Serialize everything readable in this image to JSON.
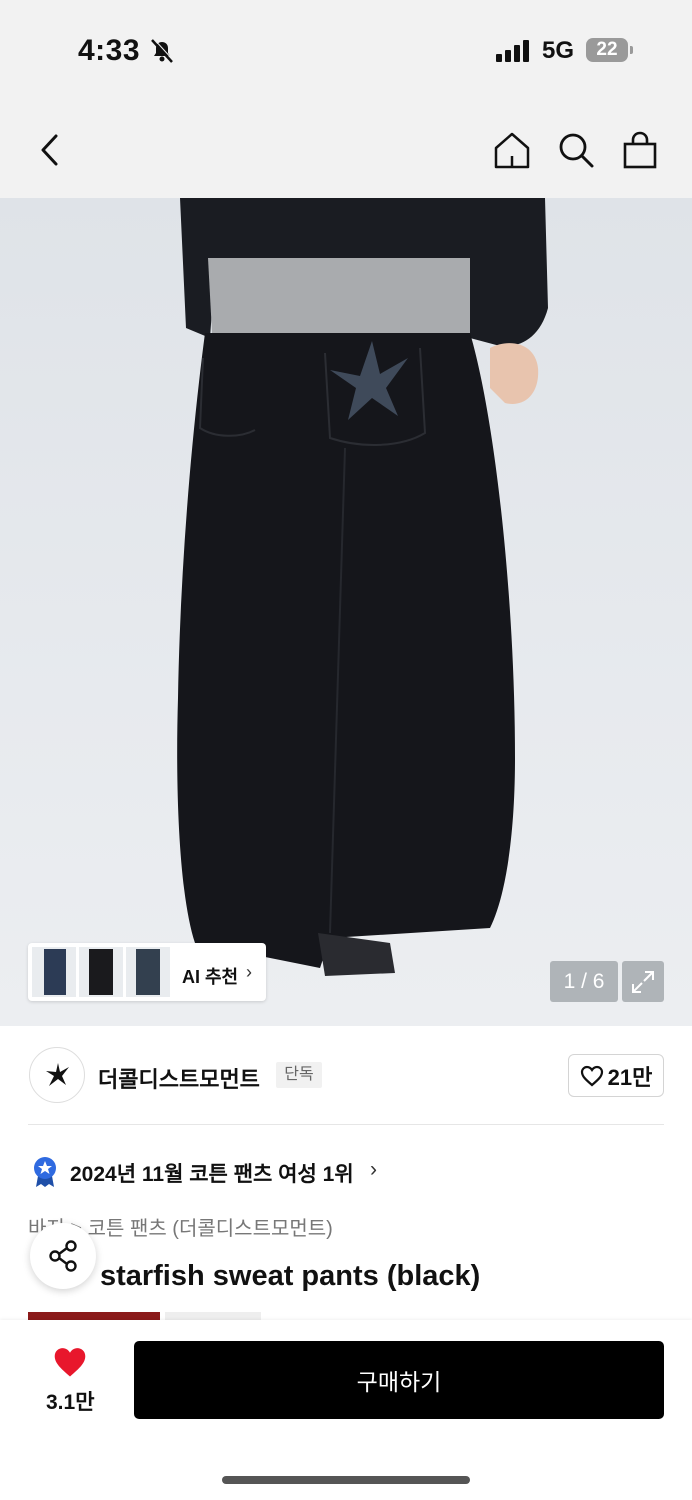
{
  "status_bar": {
    "time": "4:33",
    "network": "5G",
    "battery": "22"
  },
  "nav": {
    "back_icon": "chevron-left-icon",
    "home_icon": "home-icon",
    "search_icon": "search-icon",
    "cart_icon": "shopping-bag-icon"
  },
  "gallery": {
    "ai_reco_label": "AI 추천",
    "pager": "1 / 6",
    "expand_icon": "expand-icon"
  },
  "brand": {
    "name": "더콜디스트모먼트",
    "badge": "단독",
    "likes": "21만"
  },
  "ranking": {
    "text": "2024년 11월 코튼 팬츠 여성 1위"
  },
  "breadcrumb": "바지 > 코튼 팬츠 (더콜디스트모먼트)",
  "product_title": "starfish sweat pants (black)",
  "bottom_bar": {
    "like_count": "3.1만",
    "buy_label": "구매하기"
  },
  "colors": {
    "buy_bg": "#000000",
    "heart": "#e8172c",
    "badge_red": "#8b1a1a"
  }
}
